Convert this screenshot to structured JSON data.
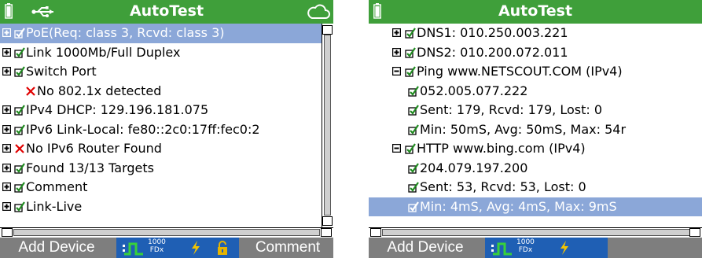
{
  "left": {
    "title": "AutoTest",
    "rows": [
      {
        "expander": "plus",
        "mark": "check",
        "text": "PoE(Req: class 3, Rcvd: class 3)",
        "selected": true
      },
      {
        "expander": "plus",
        "mark": "check",
        "text": "Link 1000Mb/Full Duplex"
      },
      {
        "expander": "plus",
        "mark": "check",
        "text": "Switch Port"
      },
      {
        "expander": "none",
        "mark": "cross",
        "text": "No 802.1x detected"
      },
      {
        "expander": "plus",
        "mark": "check",
        "text": "IPv4 DHCP: 129.196.181.075"
      },
      {
        "expander": "plus",
        "mark": "check",
        "text": "IPv6 Link-Local: fe80::2c0:17ff:fec0:2"
      },
      {
        "expander": "plus",
        "mark": "cross",
        "text": "No IPv6 Router Found"
      },
      {
        "expander": "plus",
        "mark": "check",
        "text": "Found 13/13 Targets"
      },
      {
        "expander": "plus",
        "mark": "check",
        "text": "Comment"
      },
      {
        "expander": "plus",
        "mark": "check",
        "text": "Link-Live"
      }
    ],
    "bottom": {
      "add_device": "Add Device",
      "speed_top": "1000",
      "speed_bottom": "FDx",
      "comment": "Comment"
    }
  },
  "right": {
    "title": "AutoTest",
    "rows": [
      {
        "indent": 1,
        "expander": "plus",
        "mark": "check",
        "text": "DNS1: 010.250.003.221"
      },
      {
        "indent": 1,
        "expander": "plus",
        "mark": "check",
        "text": "DNS2: 010.200.072.011"
      },
      {
        "indent": 1,
        "expander": "minus",
        "mark": "check",
        "text": "Ping www.NETSCOUT.COM (IPv4)"
      },
      {
        "indent": 2,
        "expander": "none",
        "mark": "check",
        "text": "052.005.077.222"
      },
      {
        "indent": 2,
        "expander": "none",
        "mark": "check",
        "text": "Sent: 179, Rcvd: 179, Lost: 0"
      },
      {
        "indent": 2,
        "expander": "none",
        "mark": "check",
        "text": "Min: 50mS, Avg: 50mS, Max: 54r"
      },
      {
        "indent": 1,
        "expander": "minus",
        "mark": "check",
        "text": "HTTP www.bing.com (IPv4)"
      },
      {
        "indent": 2,
        "expander": "none",
        "mark": "check",
        "text": "204.079.197.200"
      },
      {
        "indent": 2,
        "expander": "none",
        "mark": "check",
        "text": "Sent: 53, Rcvd: 53, Lost: 0"
      },
      {
        "indent": 2,
        "expander": "none",
        "mark": "check",
        "text": "Min: 4mS, Avg: 4mS, Max: 9mS",
        "selected": true
      }
    ],
    "bottom": {
      "add_device": "Add Device",
      "speed_top": "1000",
      "speed_bottom": "FDx"
    }
  },
  "colors": {
    "title_bar": "#3f9f3a",
    "selection": "#8ba7d8",
    "status_strip": "#1f5fb4",
    "softkey_bar": "#7e7e7e",
    "check": "#1f8a1f",
    "cross": "#e00000",
    "bolt": "#f2c400"
  },
  "icons": [
    "battery-icon",
    "usb-icon",
    "cloud-icon",
    "plus-expander-icon",
    "minus-expander-icon",
    "check-icon",
    "cross-icon",
    "link-pulse-icon",
    "bolt-icon",
    "lock-icon"
  ]
}
